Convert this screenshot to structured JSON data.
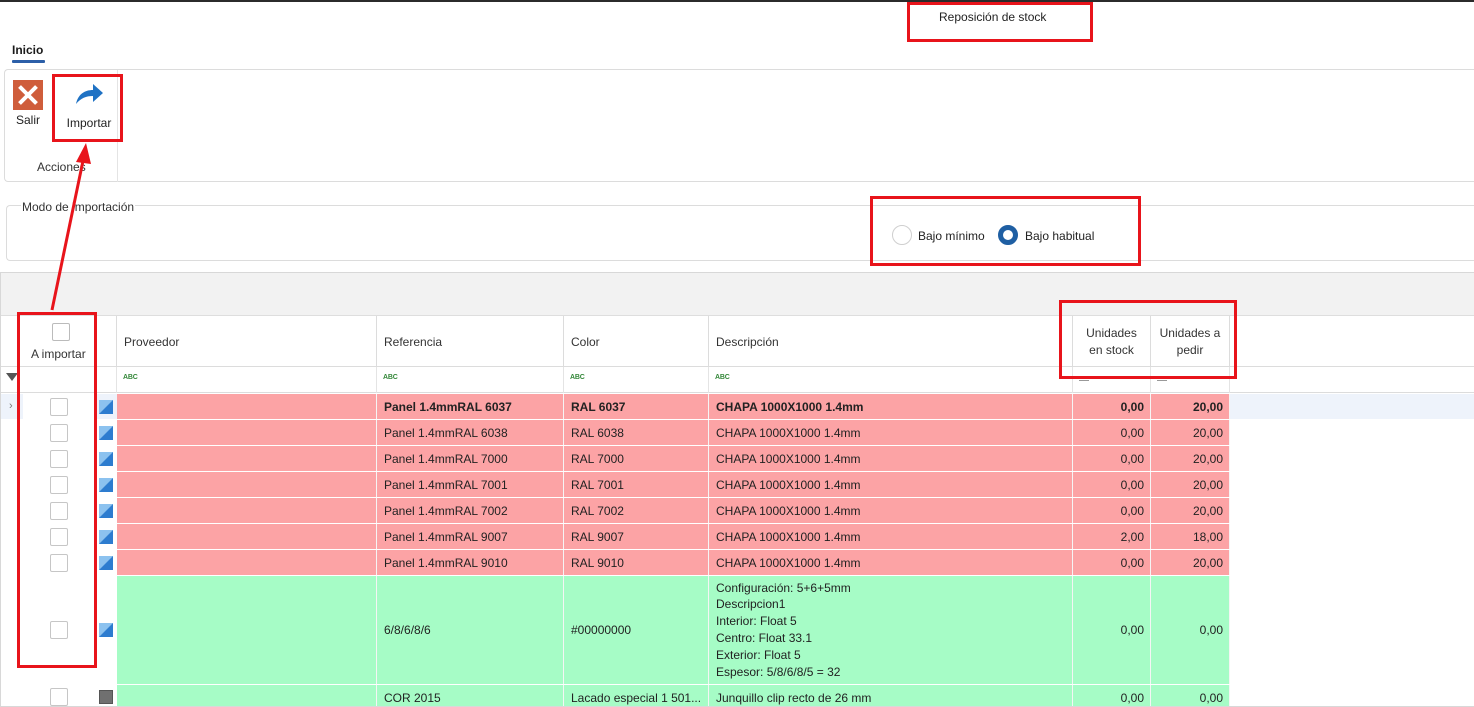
{
  "window": {
    "title": "Reposición de stock"
  },
  "ribbon": {
    "tab": "Inicio",
    "buttons": [
      {
        "id": "salir",
        "label": "Salir",
        "icon": "close-icon"
      },
      {
        "id": "importar",
        "label": "Importar",
        "icon": "share-arrow-icon"
      }
    ],
    "group_label": "Acciones"
  },
  "import_mode": {
    "legend": "Modo de importación",
    "options": [
      {
        "label": "Bajo mínimo",
        "selected": false
      },
      {
        "label": "Bajo habitual",
        "selected": true
      }
    ]
  },
  "grid": {
    "columns": {
      "a_importar": "A importar",
      "proveedor": "Proveedor",
      "referencia": "Referencia",
      "color": "Color",
      "descripcion": "Descripción",
      "unidades_stock": "Unidades\nen stock",
      "unidades_pedir": "Unidades a\npedir"
    },
    "filter_glyph": "ABC",
    "rows": [
      {
        "status": "red",
        "icon": "blue",
        "proveedor": "",
        "referencia": "Panel 1.4mmRAL 6037",
        "color": "RAL 6037",
        "descripcion": "CHAPA 1000X1000 1.4mm",
        "stock": "0,00",
        "pedir": "20,00"
      },
      {
        "status": "red",
        "icon": "blue",
        "proveedor": "",
        "referencia": "Panel 1.4mmRAL 6038",
        "color": "RAL 6038",
        "descripcion": "CHAPA 1000X1000 1.4mm",
        "stock": "0,00",
        "pedir": "20,00"
      },
      {
        "status": "red",
        "icon": "blue",
        "proveedor": "",
        "referencia": "Panel 1.4mmRAL 7000",
        "color": "RAL 7000",
        "descripcion": "CHAPA 1000X1000 1.4mm",
        "stock": "0,00",
        "pedir": "20,00"
      },
      {
        "status": "red",
        "icon": "blue",
        "proveedor": "",
        "referencia": "Panel 1.4mmRAL 7001",
        "color": "RAL 7001",
        "descripcion": "CHAPA 1000X1000 1.4mm",
        "stock": "0,00",
        "pedir": "20,00"
      },
      {
        "status": "red",
        "icon": "blue",
        "proveedor": "",
        "referencia": "Panel 1.4mmRAL 7002",
        "color": "RAL 7002",
        "descripcion": "CHAPA 1000X1000 1.4mm",
        "stock": "0,00",
        "pedir": "20,00"
      },
      {
        "status": "red",
        "icon": "blue",
        "proveedor": "",
        "referencia": "Panel 1.4mmRAL 9007",
        "color": "RAL 9007",
        "descripcion": "CHAPA 1000X1000 1.4mm",
        "stock": "2,00",
        "pedir": "18,00"
      },
      {
        "status": "red",
        "icon": "blue",
        "proveedor": "",
        "referencia": "Panel 1.4mmRAL 9010",
        "color": "RAL 9010",
        "descripcion": "CHAPA 1000X1000 1.4mm",
        "stock": "0,00",
        "pedir": "20,00"
      },
      {
        "status": "green",
        "icon": "blue",
        "proveedor": "",
        "referencia": "6/8/6/8/6",
        "color": "#00000000",
        "descripcion": "Configuración: 5+6+5mm\nDescripcion1\nInterior: Float 5\nCentro: Float 33.1\nExterior: Float 5\nEspesor: 5/8/6/8/5 = 32",
        "stock": "0,00",
        "pedir": "0,00"
      },
      {
        "status": "green",
        "icon": "gray",
        "proveedor": "",
        "referencia": "COR 2015",
        "color": "Lacado especial 1 501...",
        "descripcion": "Junquillo clip recto de 26 mm",
        "stock": "0,00",
        "pedir": "0,00"
      }
    ]
  },
  "colors": {
    "accent": "#1f5fa3",
    "row_red": "#fca3a5",
    "row_green": "#a6fcc6",
    "annotation": "#e8141b"
  }
}
